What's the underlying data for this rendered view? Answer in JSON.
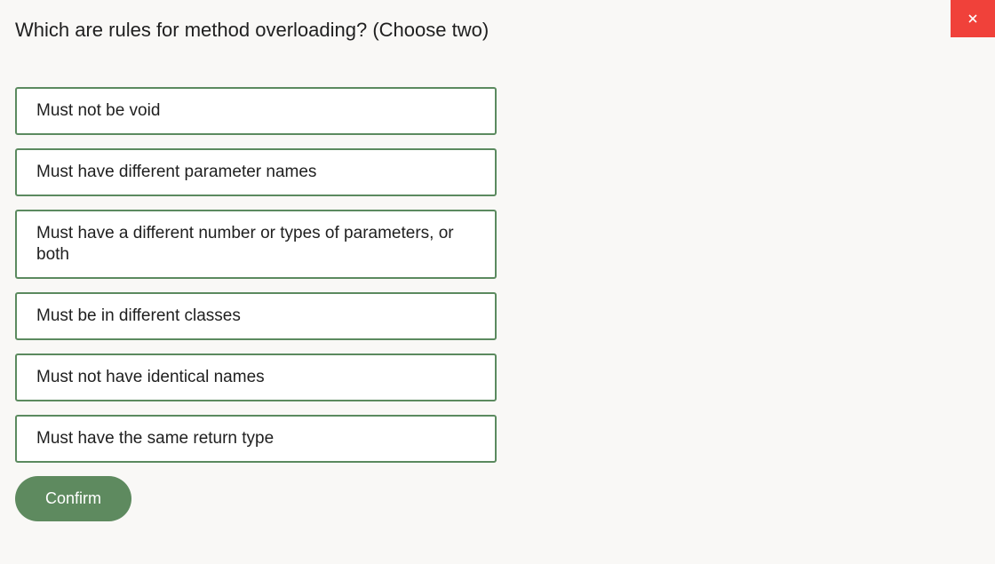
{
  "question": {
    "text": "Which are rules for method overloading? (Choose two)"
  },
  "options": [
    {
      "label": "Must not be void"
    },
    {
      "label": "Must have different parameter names"
    },
    {
      "label": "Must have a different number or types of parameters, or both"
    },
    {
      "label": "Must be in different classes"
    },
    {
      "label": "Must not have identical names"
    },
    {
      "label": "Must have the same return type"
    }
  ],
  "confirm": {
    "label": "Confirm"
  },
  "close": {
    "icon": "close-icon"
  },
  "colors": {
    "background": "#f9f8f6",
    "option_border": "#5b8a5f",
    "confirm_bg": "#5e8a5f",
    "close_bg": "#f0413a"
  }
}
